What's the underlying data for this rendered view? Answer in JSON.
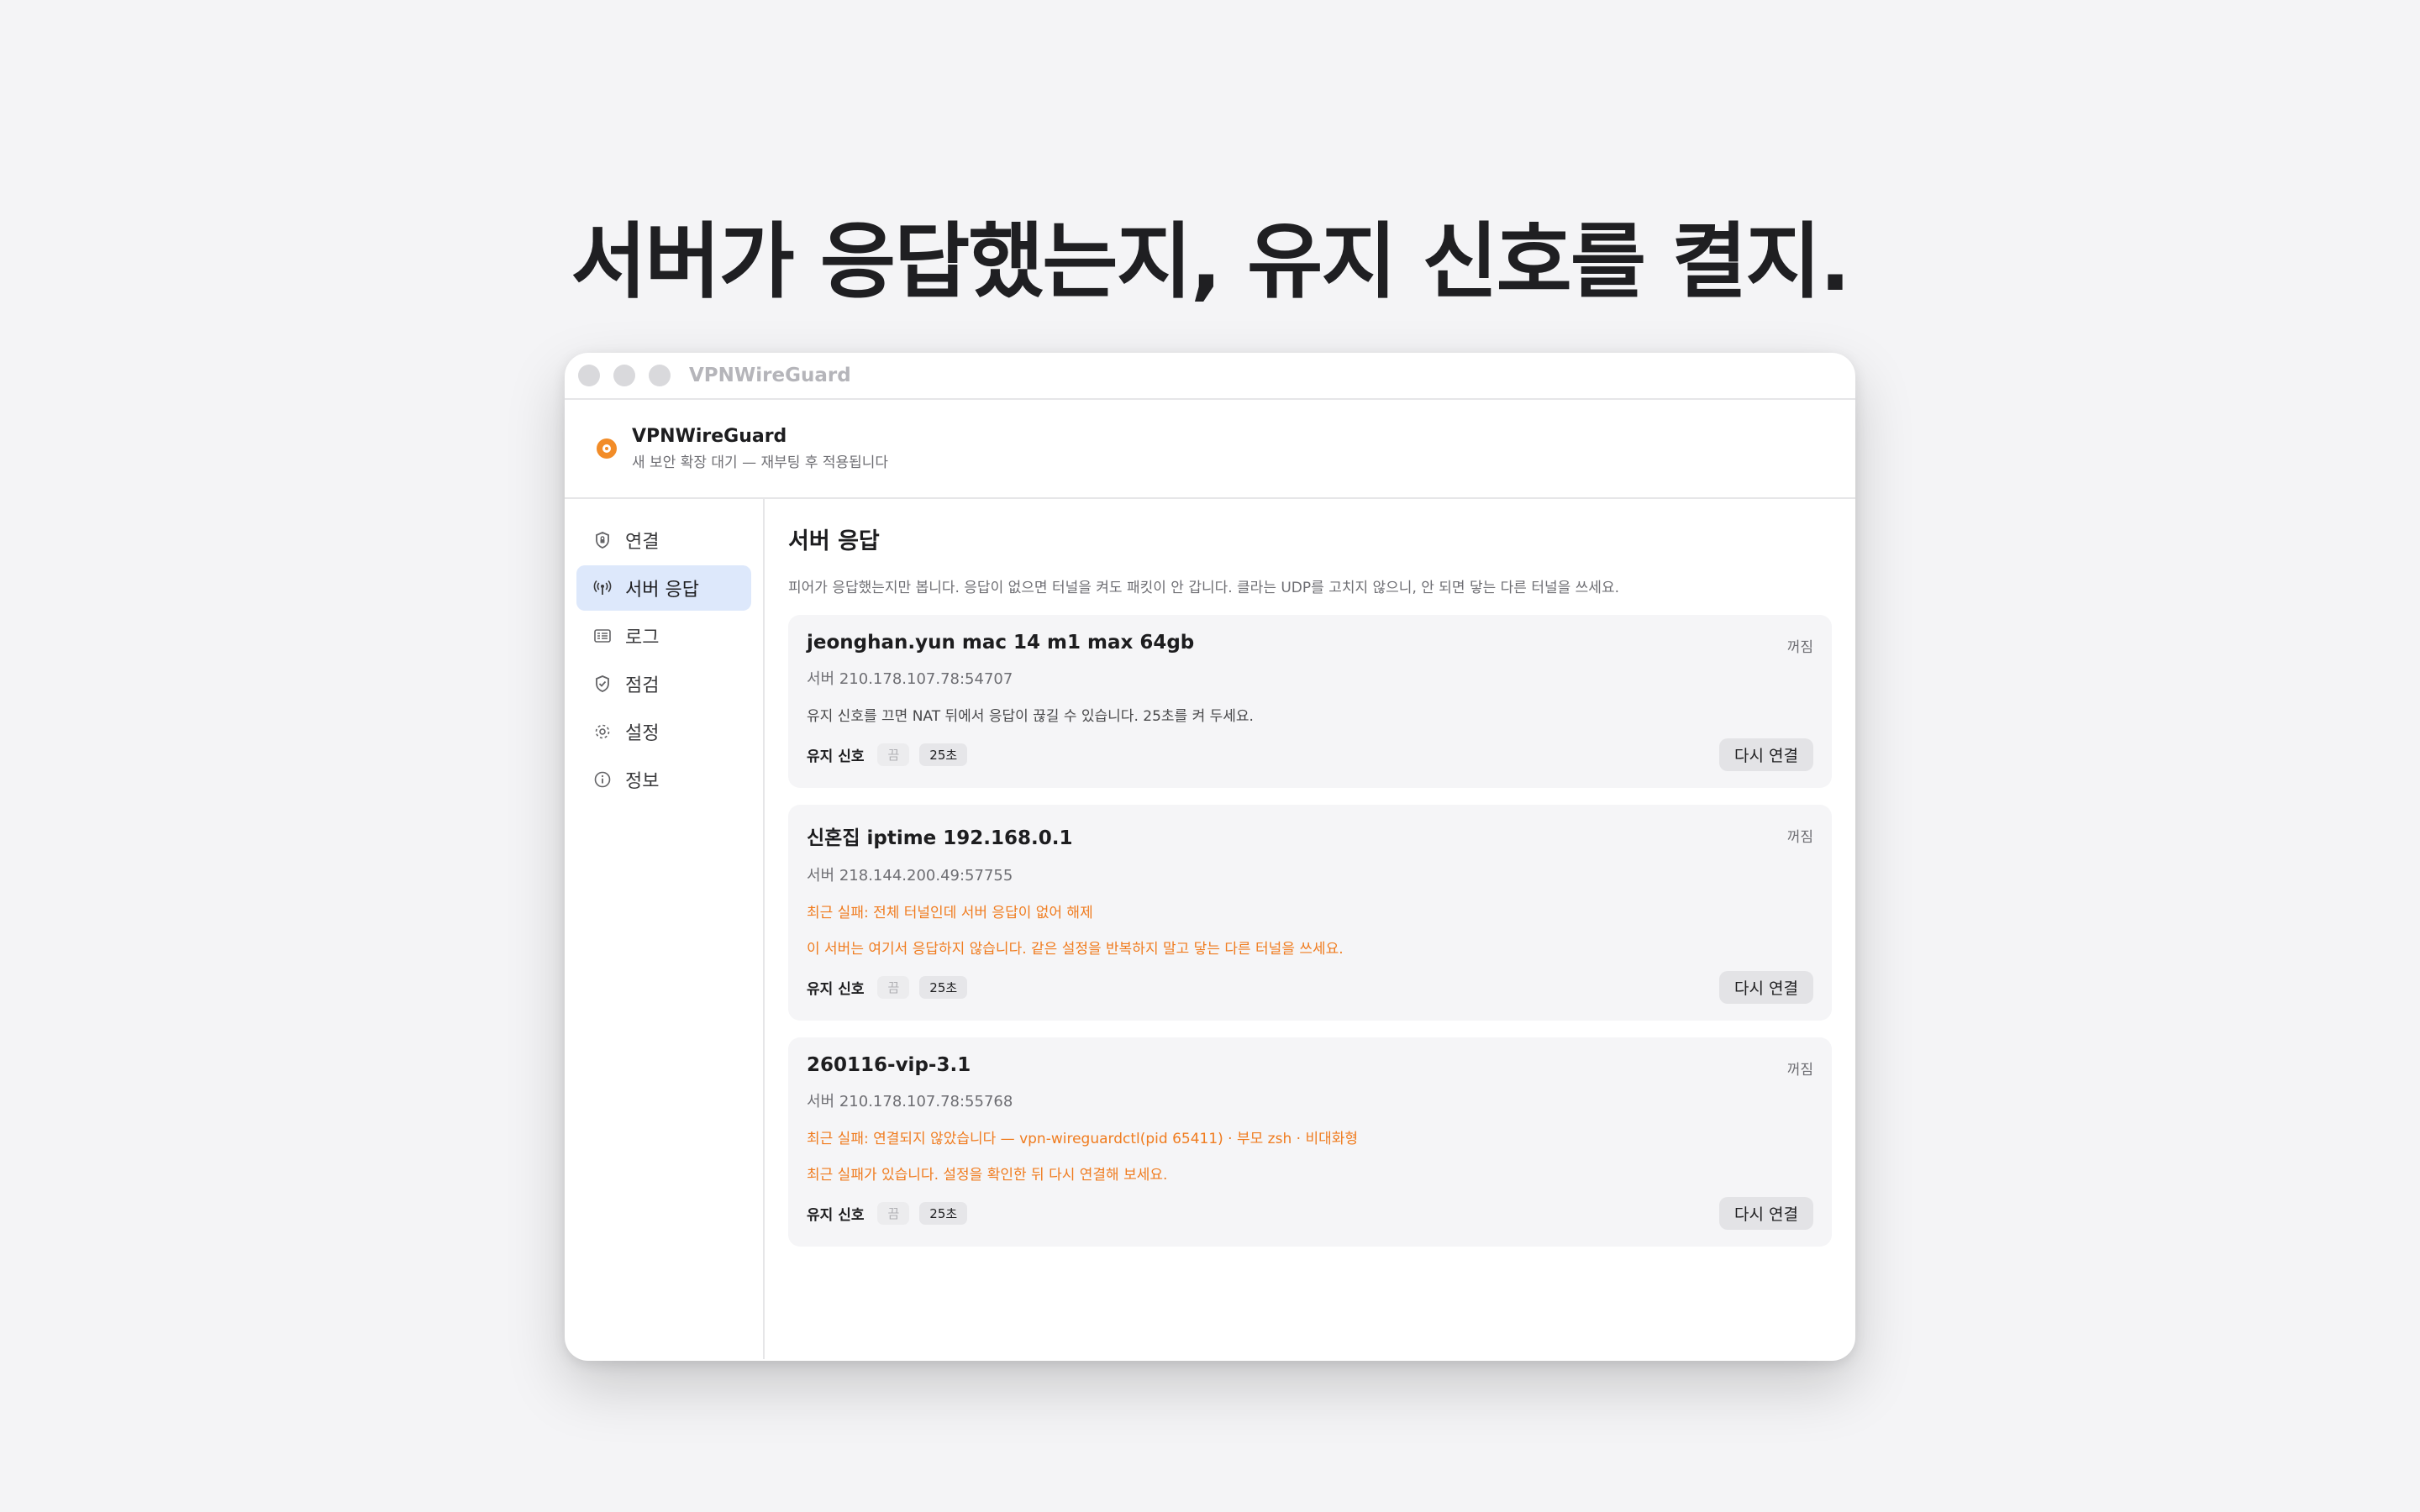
{
  "headline": "서버가 응답했는지, 유지 신호를 켤지.",
  "window": {
    "title": "VPNWireGuard"
  },
  "app_header": {
    "name": "VPNWireGuard",
    "subtitle": "새 보안 확장 대기 — 재부팅 후 적용됩니다",
    "status_color": "#f28c28"
  },
  "sidebar": {
    "items": [
      {
        "label": "연결",
        "icon": "shield-lock-icon"
      },
      {
        "label": "서버 응답",
        "icon": "antenna-icon",
        "active": true
      },
      {
        "label": "로그",
        "icon": "log-list-icon"
      },
      {
        "label": "점검",
        "icon": "shield-check-icon"
      },
      {
        "label": "설정",
        "icon": "gear-icon"
      },
      {
        "label": "정보",
        "icon": "info-icon"
      }
    ]
  },
  "main": {
    "title": "서버 응답",
    "description": "피어가 응답했는지만 봅니다. 응답이 없으면 터널을 켜도 패킷이 안 갑니다. 클라는 UDP를 고치지 않으니, 안 되면 닿는 다른 터널을 쓰세요.",
    "keepalive_label": "유지 신호",
    "keepalive_off": "끔",
    "keepalive_value": "25초",
    "reconnect_label": "다시 연결",
    "cards": [
      {
        "name": "jeonghan.yun mac 14 m1 max 64gb",
        "state": "꺼짐",
        "server": "서버 210.178.107.78:54707",
        "note": "유지 신호를 끄면 NAT 뒤에서 응답이 끊길 수 있습니다. 25초를 켜 두세요."
      },
      {
        "name": "신혼집 iptime 192.168.0.1",
        "state": "꺼짐",
        "server": "서버 218.144.200.49:57755",
        "error1": "최근 실패: 전체 터널인데 서버 응답이 없어 해제",
        "error2": "이 서버는 여기서 응답하지 않습니다. 같은 설정을 반복하지 말고 닿는 다른 터널을 쓰세요."
      },
      {
        "name": "260116-vip-3.1",
        "state": "꺼짐",
        "server": "서버 210.178.107.78:55768",
        "error1": "최근 실패: 연결되지 않았습니다 — vpn-wireguardctl(pid 65411) · 부모 zsh · 비대화형",
        "error2": "최근 실패가 있습니다. 설정을 확인한 뒤 다시 연결해 보세요."
      }
    ]
  }
}
